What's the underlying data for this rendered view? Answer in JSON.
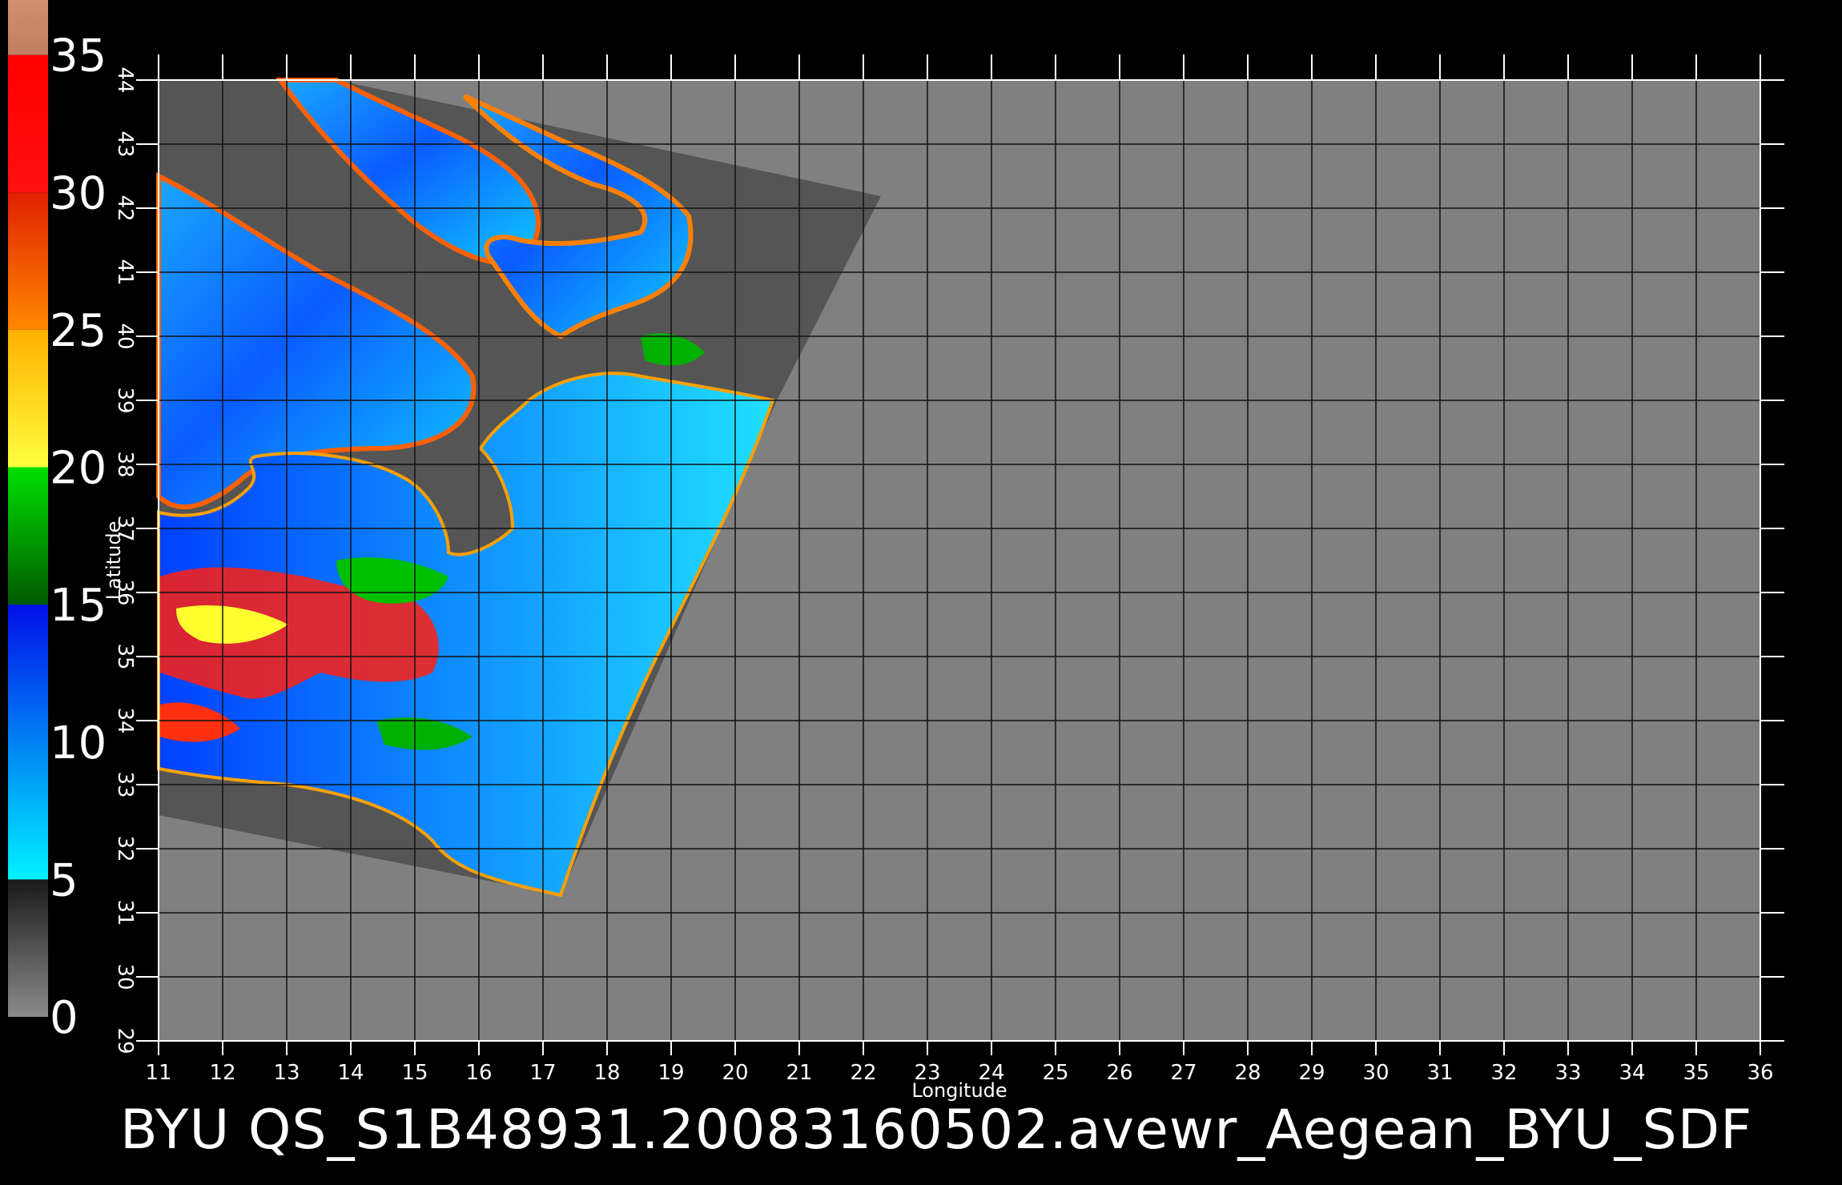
{
  "colorbar": {
    "labels": [
      "35",
      "30",
      "25",
      "20",
      "15",
      "10",
      "5",
      "0"
    ],
    "values": [
      35,
      30,
      25,
      20,
      15,
      10,
      5,
      0
    ],
    "segments": [
      {
        "from": 0,
        "to": 5,
        "colors": [
          "#8a8a8a",
          "#1a1a1a"
        ]
      },
      {
        "from": 5,
        "to": 15,
        "colors": [
          "#00f2ff",
          "#0010e8"
        ]
      },
      {
        "from": 15,
        "to": 20,
        "colors": [
          "#005a00",
          "#00e000"
        ]
      },
      {
        "from": 20,
        "to": 25,
        "colors": [
          "#ffff40",
          "#ffb000"
        ]
      },
      {
        "from": 25,
        "to": 30,
        "colors": [
          "#ff8800",
          "#e02000"
        ]
      },
      {
        "from": 30,
        "to": 35,
        "colors": [
          "#ff1010",
          "#ff0000"
        ]
      },
      {
        "from": 35,
        "to": 37,
        "colors": [
          "#c08060",
          "#d09070"
        ]
      }
    ]
  },
  "map": {
    "lon_range": [
      11,
      36
    ],
    "lat_range": [
      29,
      44
    ],
    "lon_ticks": [
      "11",
      "12",
      "13",
      "14",
      "15",
      "16",
      "17",
      "18",
      "19",
      "20",
      "21",
      "22",
      "23",
      "24",
      "25",
      "26",
      "27",
      "28",
      "29",
      "30",
      "31",
      "32",
      "33",
      "34",
      "35",
      "36"
    ],
    "lat_ticks": [
      "29",
      "30",
      "31",
      "32",
      "33",
      "34",
      "35",
      "36",
      "37",
      "38",
      "39",
      "40",
      "41",
      "42",
      "43",
      "44"
    ],
    "xlabel": "Longitude",
    "ylabel": "Latitude",
    "grid": true,
    "background_color": "#808080",
    "swath_color": "#555555"
  },
  "caption": "BYU  QS_S1B48931.20083160502.avewr_Aegean_BYU_SDF"
}
